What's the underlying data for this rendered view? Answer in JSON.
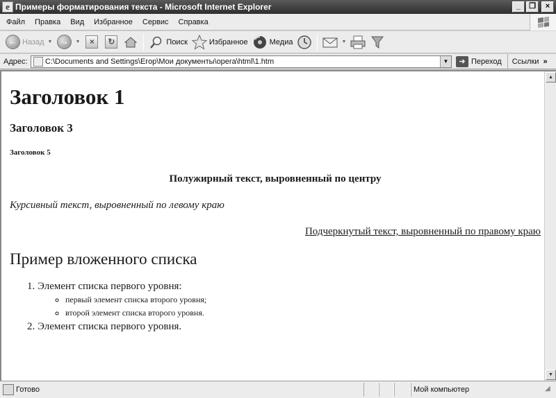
{
  "window": {
    "title": "Примеры форматирования текста - Microsoft Internet Explorer",
    "app_icon": "ie-icon",
    "controls": {
      "minimize": "_",
      "maximize": "❐",
      "close": "×"
    }
  },
  "menu": {
    "items": [
      "Файл",
      "Правка",
      "Вид",
      "Избранное",
      "Сервис",
      "Справка"
    ]
  },
  "toolbar": {
    "back_label": "Назад",
    "search_label": "Поиск",
    "favorites_label": "Избранное",
    "media_label": "Медиа"
  },
  "address": {
    "label": "Адрес:",
    "value": "C:\\Documents and Settings\\Егор\\Мои документы\\opera\\html\\1.htm",
    "go_label": "Переход",
    "links_label": "Ссылки"
  },
  "page": {
    "h1": "Заголовок 1",
    "h3": "Заголовок 3",
    "h5": "Заголовок 5",
    "center_bold": "Полужирный текст, выровненный по центру",
    "left_italic": "Курсивный текст, выровненный по левому краю",
    "right_underline": "Подчеркнутый текст, выровненный по правому краю",
    "h2": "Пример вложенного списка",
    "list": {
      "item1": "Элемент списка первого уровня:",
      "subitems": [
        "первый элемент списка второго уровня;",
        "второй элемент списка второго уровня."
      ],
      "item2": "Элемент списка первого уровня."
    }
  },
  "status": {
    "text": "Готово",
    "zone": "Мой компьютер"
  }
}
